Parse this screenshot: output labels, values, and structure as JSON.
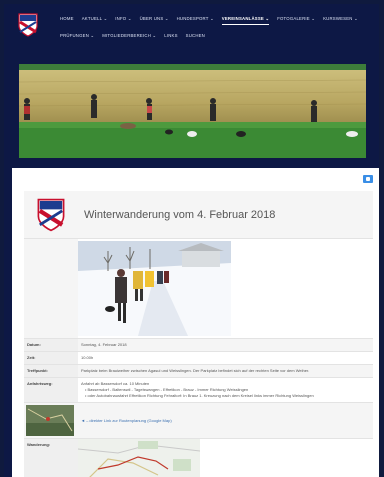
{
  "nav": {
    "row1": [
      "HOME",
      "AKTUELL",
      "INFO",
      "ÜBER UNS",
      "HUNDESPORT",
      "VEREINSANLÄSSE",
      "FOTOGALERIE",
      "KURSWESEN"
    ],
    "row1_dropdown": [
      false,
      true,
      true,
      true,
      true,
      true,
      true,
      true
    ],
    "row2": [
      "PRÜFUNGEN",
      "MITGLIEDERBEREICH",
      "LINKS",
      "SUCHEN"
    ],
    "row2_dropdown": [
      true,
      true,
      false,
      false
    ],
    "active": "VEREINSANLÄSSE",
    "caret": "⌄"
  },
  "event": {
    "title": "Winterwanderung vom 4. Februar 2018",
    "rows": {
      "datum_label": "Datum:",
      "datum_value": "Sonntag, 4. Februar 2018",
      "zeit_label": "Zeit:",
      "zeit_value": "10.00h",
      "treffpunkt_label": "Treffpunkt:",
      "treffpunkt_value": "Parkplatz beim Brauiweiher zwischen Agasul und Weisslingen. Der Parkplatz befindet sich auf der rechten Seite vor dem Weiher.",
      "anfahrt_label": "Anfahrtsweg:",
      "anfahrt_intro": "Anfahrt ab Bassersdorf ca. 10 Minuten",
      "anfahrt_lines": [
        "Bassersdorf - Baltenswil - Tagelswangen - Effretikon - Brauz - Immer Richtung Weisslingen",
        "oder Autobahnausfahrt Effretikon Richtung Fehraltorf: In Brauz 1. Kreuzung nach dem Kreisel links immer Richtung Weisslingen"
      ],
      "map_link": "◄ – direkter Link zur Routenplanung (Google Map)",
      "wanderung_label": "Wanderung:"
    }
  },
  "colors": {
    "nav_bg": "#0d1845",
    "print_button": "#3a8ee6"
  },
  "icons": [
    "crest-logo-icon",
    "print-icon",
    "map-thumbnail"
  ]
}
